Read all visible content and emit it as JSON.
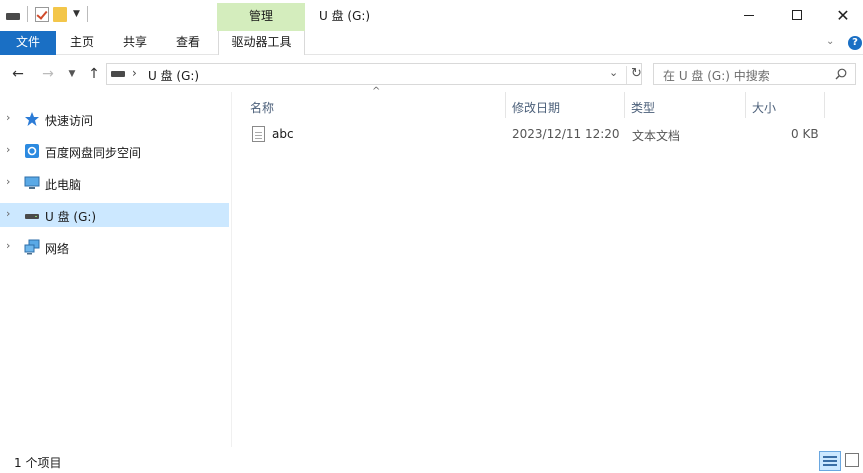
{
  "window": {
    "context_tab": "管理",
    "title": "U 盘 (G:)"
  },
  "ribbon": {
    "tabs": {
      "file": "文件",
      "home": "主页",
      "share": "共享",
      "view": "查看",
      "drive_tools": "驱动器工具"
    },
    "help": "?"
  },
  "address": {
    "separator": "›",
    "path": "U 盘 (G:)",
    "search_placeholder": "在 U 盘 (G:) 中搜索"
  },
  "nav_pane": {
    "items": [
      {
        "label": "快速访问",
        "icon": "star-icon"
      },
      {
        "label": "百度网盘同步空间",
        "icon": "baidu-netdisk-icon"
      },
      {
        "label": "此电脑",
        "icon": "computer-icon"
      },
      {
        "label": "U 盘 (G:)",
        "icon": "usb-drive-icon",
        "selected": true
      },
      {
        "label": "网络",
        "icon": "network-icon"
      }
    ]
  },
  "file_list": {
    "columns": {
      "name": "名称",
      "modified": "修改日期",
      "type": "类型",
      "size": "大小"
    },
    "rows": [
      {
        "name": "abc",
        "modified": "2023/12/11 12:20",
        "type": "文本文档",
        "size": "0 KB"
      }
    ]
  },
  "status": {
    "item_count": "1 个项目"
  },
  "colors": {
    "accent": "#1a6fc4",
    "selection": "#cce8ff",
    "manage_tab": "#d4edbd"
  }
}
